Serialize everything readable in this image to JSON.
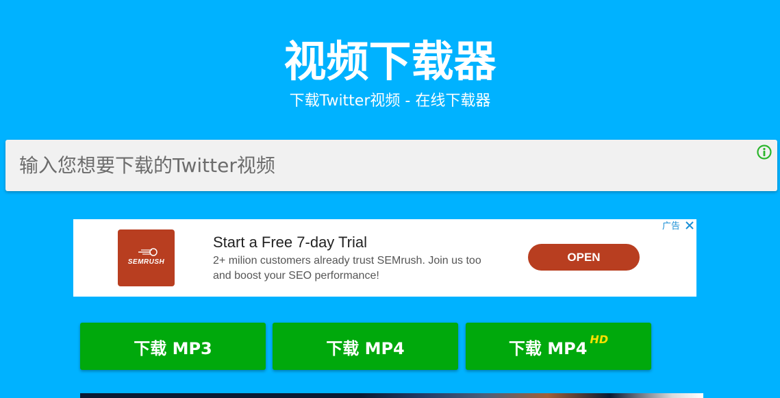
{
  "header": {
    "title": "视频下载器",
    "subtitle": "下载Twitter视频 - 在线下载器"
  },
  "search": {
    "placeholder": "输入您想要下载的Twitter视频",
    "value": "",
    "info_icon": "info-circle-icon"
  },
  "ad": {
    "brand": "SEMRUSH",
    "headline": "Start a Free 7-day Trial",
    "description": "2+ milion customers already trust SEMrush. Join us too and boost your SEO performance!",
    "open_label": "OPEN",
    "ad_label": "广告",
    "close_icon": "close-icon",
    "accent_color": "#b83e20"
  },
  "downloads": {
    "mp3_label": "下载 MP3",
    "mp4_label": "下载 MP4",
    "mp4hd_label": "下载 MP4",
    "hd_badge": "HD"
  },
  "colors": {
    "background": "#00b2ff",
    "button_green": "#00a90c",
    "hd_yellow": "#ffe100",
    "info_green": "#2bb52b"
  }
}
